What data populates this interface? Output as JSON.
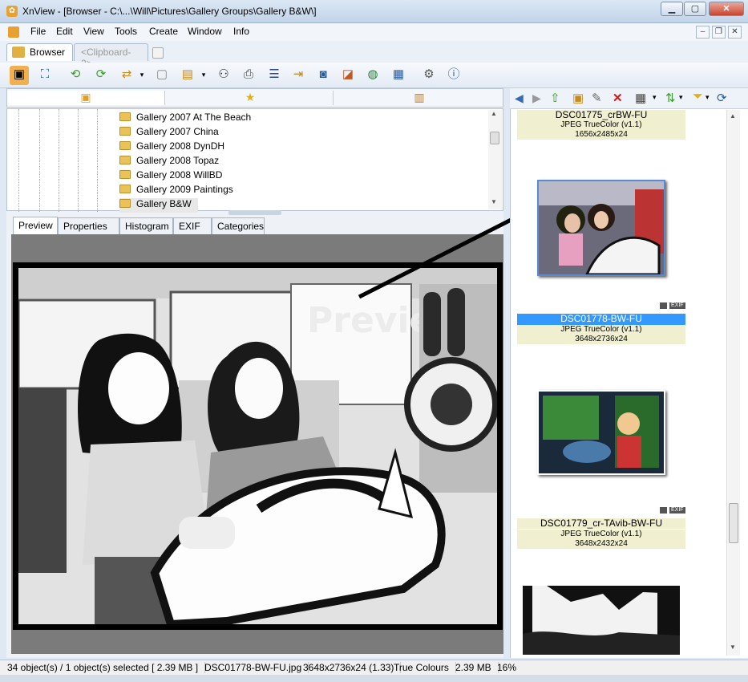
{
  "window": {
    "title": "XnView - [Browser - C:\\...\\Will\\Pictures\\Gallery Groups\\Gallery B&W\\]"
  },
  "caption_buttons": {
    "minimize": "▁",
    "maximize": "▢",
    "close": "✕"
  },
  "menu": [
    "File",
    "Edit",
    "View",
    "Tools",
    "Create",
    "Window",
    "Info"
  ],
  "mdi_buttons": {
    "minimize": "–",
    "restore": "❐",
    "close": "✕"
  },
  "tabs": {
    "browser": "Browser",
    "clipboard": "<Clipboard-2>"
  },
  "tree": [
    "Gallery 2007 At The Beach",
    "Gallery 2007 China",
    "Gallery 2008 DynDH",
    "Gallery 2008 Topaz",
    "Gallery 2008 WillBD",
    "Gallery 2009 Paintings",
    "Gallery B&W"
  ],
  "preview_tabs": [
    "Preview",
    "Properties",
    "Histogram",
    "EXIF",
    "Categories"
  ],
  "preview_watermark": "Preview",
  "thumbs": [
    {
      "name": "DSC01775_crBW-FU",
      "type": "JPEG TrueColor (v1.1)",
      "dims": "1656x2485x24"
    },
    {
      "name": "DSC01778-BW-FU",
      "type": "JPEG TrueColor (v1.1)",
      "dims": "3648x2736x24",
      "badge": "EXIF"
    },
    {
      "name": "DSC01779_cr-TAvib-BW-FU",
      "type": "JPEG TrueColor (v1.1)",
      "dims": "3648x2432x24",
      "badge": "EXIF"
    }
  ],
  "status": {
    "count": "34 object(s) / 1 object(s) selected  [ 2.39 MB ]",
    "file": "DSC01778-BW-FU.jpg",
    "dims": "3648x2736x24 (1.33)",
    "colours": "True Colours",
    "size": "2.39 MB",
    "zoom": "16%"
  },
  "colors": {
    "selection": "#3399ff",
    "info_bg": "#f0f0d0",
    "close": "#c8452f"
  }
}
